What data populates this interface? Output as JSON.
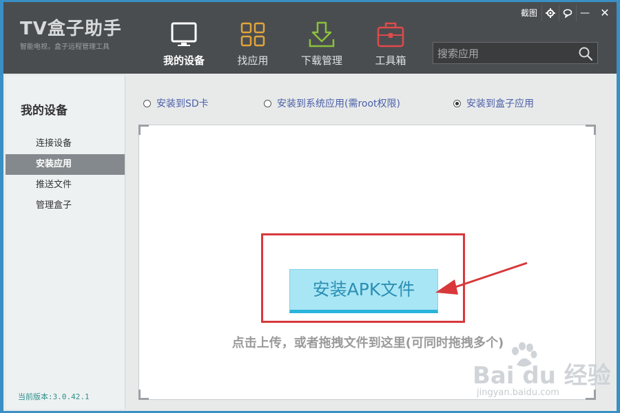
{
  "app": {
    "name": "TV盒子助手",
    "tagline": "智能电视，盒子远程管理工具"
  },
  "window_controls": {
    "screenshot_label": "截图",
    "settings_icon": "gear-icon",
    "feedback_icon": "chat-icon",
    "minimize_symbol": "—",
    "close_symbol": "✕"
  },
  "nav": {
    "items": [
      {
        "label": "我的设备",
        "icon": "tablet-icon",
        "active": true
      },
      {
        "label": "找应用",
        "icon": "grid-icon",
        "active": false
      },
      {
        "label": "下载管理",
        "icon": "download-icon",
        "active": false
      },
      {
        "label": "工具箱",
        "icon": "toolbox-icon",
        "active": false
      }
    ]
  },
  "search": {
    "placeholder": "搜索应用",
    "value": ""
  },
  "sidebar": {
    "title": "我的设备",
    "items": [
      {
        "label": "连接设备",
        "active": false
      },
      {
        "label": "安装应用",
        "active": true
      },
      {
        "label": "推送文件",
        "active": false
      },
      {
        "label": "管理盒子",
        "active": false
      }
    ],
    "version": "当前版本:3.0.42.1"
  },
  "install_options": [
    {
      "label": "安装到SD卡",
      "checked": false
    },
    {
      "label": "安装到系统应用(需root权限)",
      "checked": false
    },
    {
      "label": "安装到盒子应用",
      "checked": true
    }
  ],
  "dropzone": {
    "button_label": "安装APK文件",
    "hint": "点击上传，或者拖拽文件到这里(可同时拖拽多个)"
  },
  "watermark": {
    "logo": "Bai du 经验",
    "url": "jingyan.baidu.com"
  },
  "colors": {
    "titlebar": "#4a4d50",
    "accent_icon": "#e2a53a",
    "download_icon": "#8ac23a",
    "toolbox_icon": "#e04a4a",
    "button": "#a9e6f5",
    "button_border": "#2bb3dc",
    "highlight": "#d8383a"
  }
}
